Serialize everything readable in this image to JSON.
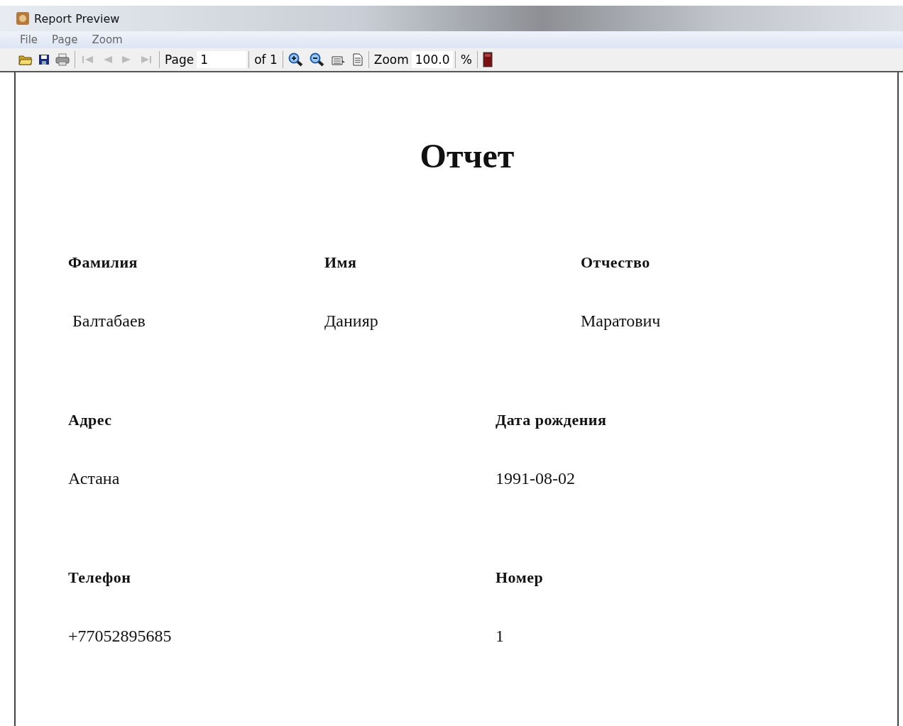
{
  "window": {
    "title": "Report Preview"
  },
  "menu": [
    "File",
    "Page",
    "Zoom"
  ],
  "toolbar": {
    "tools": [
      {
        "kind": "open",
        "disabled": false
      },
      {
        "kind": "save",
        "disabled": false
      },
      {
        "kind": "print",
        "disabled": false
      }
    ],
    "nav": [
      {
        "kind": "first",
        "disabled": true
      },
      {
        "kind": "prev",
        "disabled": true
      },
      {
        "kind": "next",
        "disabled": true
      },
      {
        "kind": "last",
        "disabled": true
      }
    ],
    "page_label": "Page",
    "page_value": "1",
    "page_total": "of 1",
    "zoom_tools": [
      {
        "kind": "zoom-in"
      },
      {
        "kind": "zoom-out"
      },
      {
        "kind": "page-width"
      },
      {
        "kind": "whole-page"
      }
    ],
    "zoom_label": "Zoom",
    "zoom_value": "100.0",
    "zoom_unit": "%"
  },
  "report": {
    "title": "Отчет",
    "rows": [
      [
        {
          "label": "Фамилия",
          "value": " Балтабаев"
        },
        {
          "label": "Имя",
          "value": "Данияр"
        },
        {
          "label": "Отчество",
          "value": "Маратович"
        }
      ],
      [
        {
          "label": "Адрес",
          "value": "Астана"
        },
        {
          "label": "Дата рождения",
          "value": "1991-08-02"
        }
      ],
      [
        {
          "label": "Телефон",
          "value": "+77052895685"
        },
        {
          "label": "Номер",
          "value": "1"
        }
      ]
    ]
  }
}
